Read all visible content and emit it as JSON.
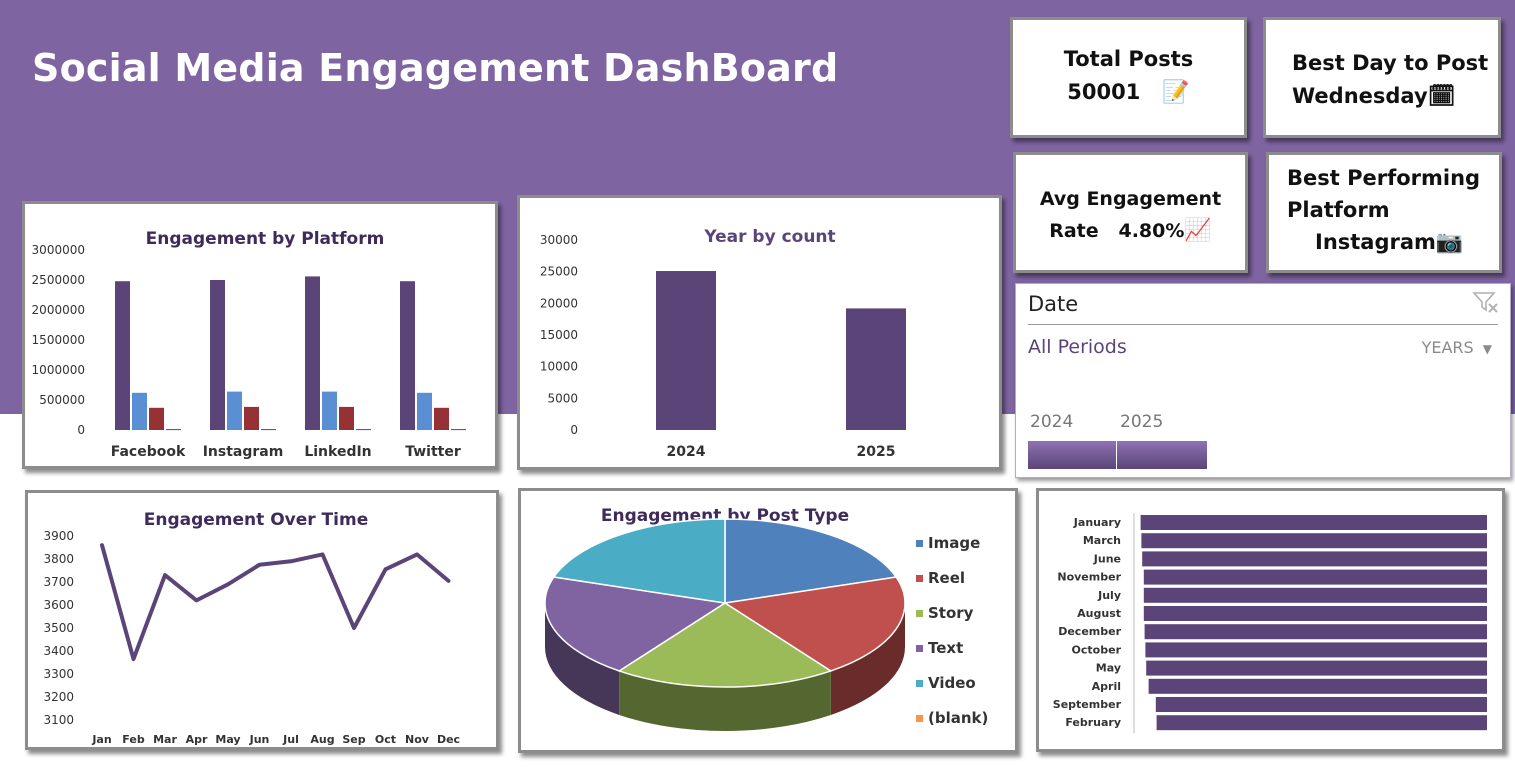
{
  "title": "Social Media Engagement DashBoard",
  "kpis": {
    "total_posts": {
      "label": "Total Posts",
      "value": "50001",
      "icon": "memo-icon"
    },
    "best_day": {
      "label": "Best Day to Post",
      "value": "Wednesday",
      "icon": "calendar-icon"
    },
    "avg_engagement": {
      "label_line1": "Avg Engagement",
      "label_line2": "Rate",
      "value": "4.80%",
      "icon": "chart-increasing-icon"
    },
    "best_platform": {
      "label_line1": "Best Performing",
      "label_line2": "Platform",
      "value": "Instagram",
      "icon": "camera-icon"
    }
  },
  "slicer": {
    "title": "Date",
    "selection": "All Periods",
    "level": "YEARS",
    "years": [
      "2024",
      "2025"
    ]
  },
  "colors": {
    "banner": "#7f64a2",
    "dark_purple": "#5b4578",
    "title_text": "#3e2b5c"
  },
  "chart_data": [
    {
      "id": "platform",
      "type": "bar",
      "title": "Engagement by Platform",
      "categories": [
        "Facebook",
        "Instagram",
        "LinkedIn",
        "Twitter"
      ],
      "series": [
        {
          "values": [
            2480000,
            2500000,
            2560000,
            2480000
          ],
          "color": "#5b4578"
        },
        {
          "values": [
            620000,
            640000,
            640000,
            620000
          ],
          "color": "#5b8fd4"
        },
        {
          "values": [
            370000,
            385000,
            385000,
            370000
          ],
          "color": "#963234"
        },
        {
          "values": [
            15000,
            15000,
            15000,
            15000
          ],
          "color": "#5b4578"
        }
      ],
      "ylim": [
        0,
        3000000
      ],
      "yticks": [
        0,
        500000,
        1000000,
        1500000,
        2000000,
        2500000,
        3000000
      ],
      "legend": "none"
    },
    {
      "id": "year",
      "type": "bar",
      "title": "Year by count",
      "categories": [
        "2024",
        "2025"
      ],
      "values": [
        25100,
        19200
      ],
      "ylim": [
        0,
        30000
      ],
      "yticks": [
        0,
        5000,
        10000,
        15000,
        20000,
        25000,
        30000
      ],
      "color": "#5b4578",
      "legend": "none"
    },
    {
      "id": "time",
      "type": "line",
      "title": "Engagement Over Time",
      "categories": [
        "Jan",
        "Feb",
        "Mar",
        "Apr",
        "May",
        "Jun",
        "Jul",
        "Aug",
        "Sep",
        "Oct",
        "Nov",
        "Dec"
      ],
      "values": [
        3860,
        3365,
        3730,
        3620,
        3690,
        3775,
        3790,
        3820,
        3500,
        3755,
        3820,
        3705
      ],
      "ylim": [
        3100,
        3900
      ],
      "yticks": [
        3100,
        3200,
        3300,
        3400,
        3500,
        3600,
        3700,
        3800,
        3900
      ],
      "color": "#5b4578",
      "legend": "none"
    },
    {
      "id": "posttype",
      "type": "pie",
      "title": "Engagement by Post Type",
      "categories": [
        "Image",
        "Reel",
        "Story",
        "Text",
        "Video",
        "(blank)"
      ],
      "values": [
        20,
        20,
        20,
        20,
        20,
        0
      ],
      "colors": [
        "#4f81bd",
        "#c0504d",
        "#9bbb59",
        "#8064a2",
        "#4bacc6",
        "#f79646"
      ],
      "legend": "right"
    },
    {
      "id": "month",
      "type": "bar",
      "orientation": "horizontal",
      "categories": [
        "January",
        "March",
        "June",
        "November",
        "July",
        "August",
        "December",
        "October",
        "May",
        "April",
        "September",
        "February"
      ],
      "values": [
        4330,
        4320,
        4310,
        4290,
        4290,
        4290,
        4280,
        4270,
        4260,
        4230,
        4140,
        4130
      ],
      "xlim": [
        0,
        4400
      ],
      "color": "#5b4578",
      "legend": "none"
    }
  ]
}
